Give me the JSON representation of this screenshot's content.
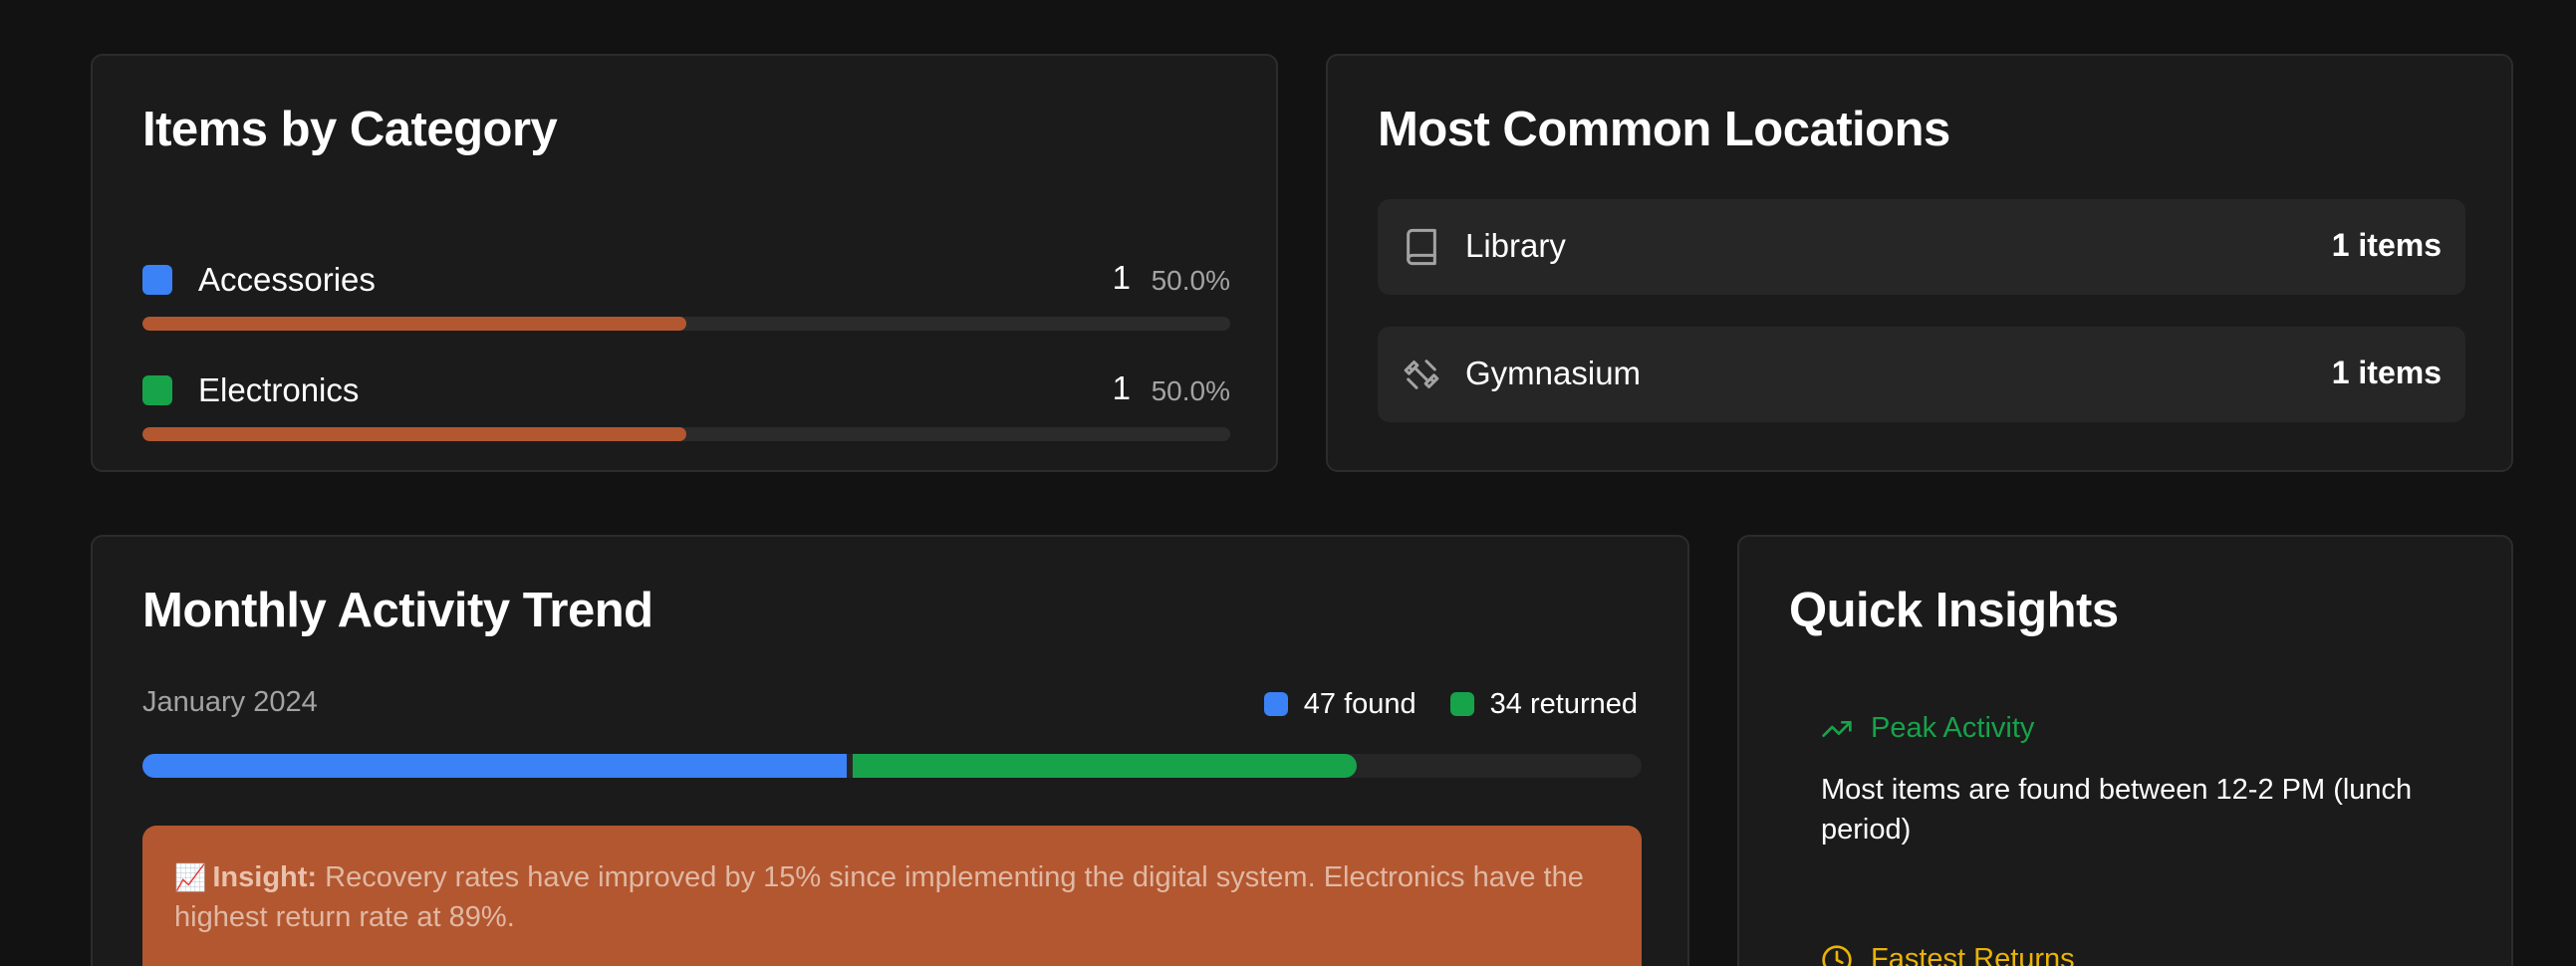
{
  "category_card": {
    "title": "Items by Category",
    "items": [
      {
        "name": "Accessories",
        "count": "1",
        "percent": "50.0%",
        "share": 0.5,
        "swatch_color": "#3b82f6"
      },
      {
        "name": "Electronics",
        "count": "1",
        "percent": "50.0%",
        "share": 0.5,
        "swatch_color": "#16a34a"
      }
    ],
    "bar_color": "#b35730"
  },
  "locations_card": {
    "title": "Most Common Locations",
    "items": [
      {
        "name": "Library",
        "count": "1 items",
        "icon": "book-icon"
      },
      {
        "name": "Gymnasium",
        "count": "1 items",
        "icon": "dumbbell-icon"
      }
    ]
  },
  "trend_card": {
    "title": "Monthly Activity Trend",
    "month": "January 2024",
    "legend": {
      "found": "47 found",
      "returned": "34 returned"
    },
    "found_fraction": 0.47,
    "returned_fraction": 0.34,
    "found_color": "#3b82f6",
    "returned_color": "#16a34a",
    "insight": {
      "emoji": "📈",
      "label": "Insight:",
      "text": "Recovery rates have improved by 15% since implementing the digital system. Electronics have the highest return rate at 89%."
    }
  },
  "quick_insights_card": {
    "title": "Quick Insights",
    "items": [
      {
        "title": "Peak Activity",
        "description": "Most items are found between 12-2 PM (lunch period)",
        "icon": "trending-up-icon",
        "color": "#16a34a"
      },
      {
        "title": "Fastest Returns",
        "description": "",
        "icon": "clock-icon",
        "color": "#eab308"
      }
    ]
  }
}
